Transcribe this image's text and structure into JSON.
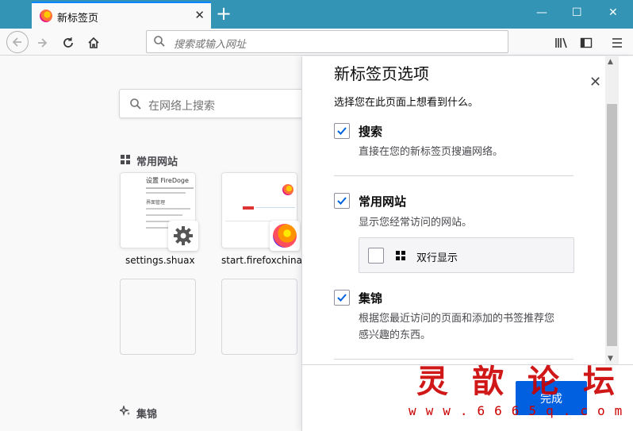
{
  "browser": {
    "tab_title": "新标签页",
    "tab_close": "✕",
    "new_tab": "+",
    "window_min": "—",
    "window_max": "☐",
    "window_close": "✕",
    "url_placeholder": "搜索或输入网址"
  },
  "newtab": {
    "search_placeholder": "在网络上搜索",
    "top_sites_title": "常用网站",
    "tiles": [
      {
        "label": "settings.shuax",
        "preview_title": "设置 FireDoge",
        "preview_section": "界面管理"
      },
      {
        "label": "start.firefoxchina"
      }
    ],
    "highlights_title": "集锦"
  },
  "panel": {
    "title": "新标签页选项",
    "close": "✕",
    "subtitle": "选择您在此页面上想看到什么。",
    "options": [
      {
        "title": "搜索",
        "desc": "直接在您的新标签页搜遍网络。",
        "checked": true
      },
      {
        "title": "常用网站",
        "desc": "显示您经常访问的网站。",
        "checked": true
      },
      {
        "title": "集锦",
        "desc_line1": "根据您最近访问的页面和添加的书签推荐您",
        "desc_line2": "感兴趣的东西。",
        "checked": true
      }
    ],
    "suboption_label": "双行显示",
    "suboption_checked": false,
    "done_label": "完成"
  },
  "watermark": {
    "big": "灵歆论坛",
    "url": "www.6665q.com"
  },
  "colors": {
    "titlebar": "#3394b5",
    "accent": "#0060df",
    "watermark": "#cc0000"
  }
}
